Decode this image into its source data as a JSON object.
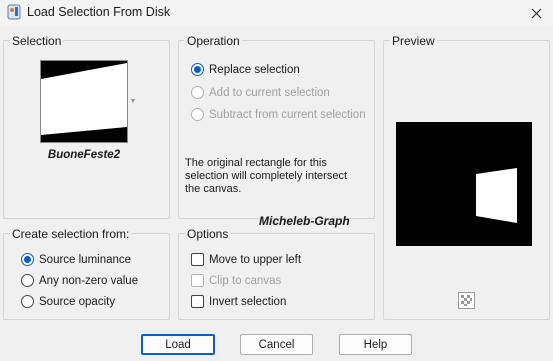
{
  "window": {
    "title": "Load Selection From Disk"
  },
  "selection": {
    "label": "Selection",
    "name": "BuoneFeste2"
  },
  "operation": {
    "label": "Operation",
    "options": [
      "Replace selection",
      "Add to current selection",
      "Subtract from current selection"
    ],
    "selected": "Replace selection",
    "description": "The original rectangle for this selection will completely intersect the canvas."
  },
  "preview": {
    "label": "Preview"
  },
  "create_from": {
    "label": "Create selection from:",
    "options": [
      "Source luminance",
      "Any non-zero value",
      "Source opacity"
    ],
    "selected": "Source luminance"
  },
  "options": {
    "label": "Options",
    "items": [
      "Move to upper left",
      "Clip to canvas",
      "Invert selection"
    ]
  },
  "watermark": "Micheleb-Graph",
  "buttons": {
    "load": "Load",
    "cancel": "Cancel",
    "help": "Help"
  },
  "colors": {
    "accent": "#0a5ec7",
    "background": "#f0f0f0"
  },
  "icons": [
    "app-icon",
    "close-icon",
    "dropdown-arrow-icon",
    "zoom-icon"
  ]
}
